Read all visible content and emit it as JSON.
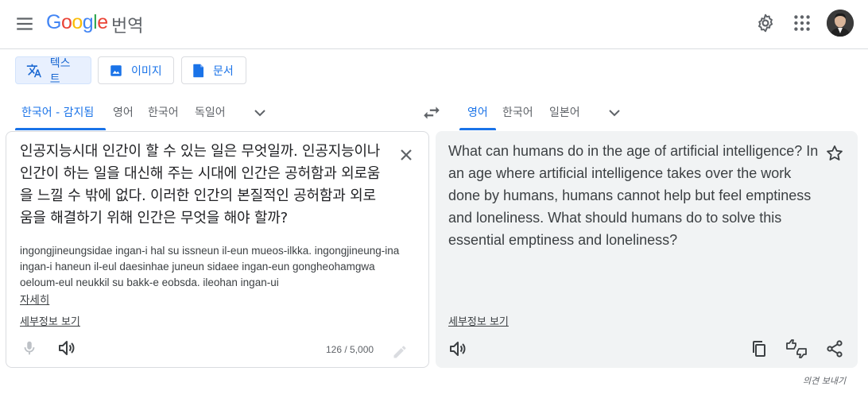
{
  "header": {
    "logo": {
      "letters": [
        "G",
        "o",
        "o",
        "g",
        "l",
        "e"
      ],
      "colors": [
        "#4285f4",
        "#ea4335",
        "#fbbc05",
        "#4285f4",
        "#34a853",
        "#ea4335"
      ]
    },
    "product": "번역"
  },
  "modes": [
    {
      "label": "텍스트",
      "icon": "translate-icon",
      "active": true
    },
    {
      "label": "이미지",
      "icon": "image-icon",
      "active": false
    },
    {
      "label": "문서",
      "icon": "document-icon",
      "active": false
    }
  ],
  "source": {
    "tabs": [
      "한국어 - 감지됨",
      "영어",
      "한국어",
      "독일어"
    ],
    "active_tab": 0,
    "text": "인공지능시대 인간이 할 수 있는 일은 무엇일까. 인공지능이나 인간이 하는 일을 대신해 주는 시대에 인간은 공허함과 외로움을 느낄 수 밖에 없다. 이러한 인간의 본질적인 공허함과 외로움을 해결하기 위해 인간은 무엇을 해야 할까?",
    "romanization": "ingongjineungsidae ingan-i hal su issneun il-eun mueos-ilkka. ingongjineung-ina ingan-i haneun il-eul daesinhae juneun sidaee ingan-eun gongheohamgwa oeloum-eul neukkil su bakk-e eobsda. ileohan ingan-ui",
    "more_link": "자세히",
    "details_link": "세부정보 보기",
    "char_count": "126 / 5,000"
  },
  "target": {
    "tabs": [
      "영어",
      "한국어",
      "일본어"
    ],
    "active_tab": 0,
    "text": "What can humans do in the age of artificial intelligence? In an age where artificial intelligence takes over the work done by humans, humans cannot help but feel emptiness and loneliness. What should humans do to solve this essential emptiness and loneliness?",
    "details_link": "세부정보 보기"
  },
  "feedback": "의견 보내기",
  "colors": {
    "accent": "#1a73e8",
    "active_bg": "#e8f0fe",
    "target_bg": "#f1f3f4"
  }
}
